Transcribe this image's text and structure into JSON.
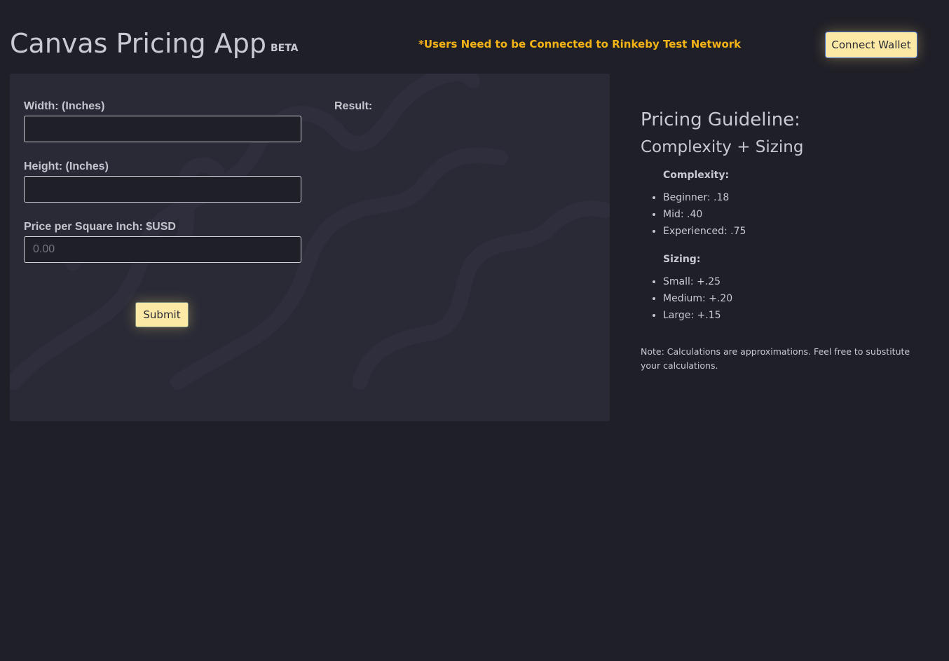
{
  "header": {
    "title": "Canvas Pricing App",
    "badge": "BETA",
    "network_notice": "*Users Need to be Connected to Rinkeby Test Network",
    "connect_wallet_label": "Connect Wallet"
  },
  "calculator": {
    "width_label": "Width: (Inches)",
    "width_value": "",
    "height_label": "Height: (Inches)",
    "height_value": "",
    "price_label": "Price per Square Inch: $USD",
    "price_placeholder": "0.00",
    "price_value": "",
    "result_label": "Result:",
    "result_value": "",
    "submit_label": "Submit"
  },
  "guideline": {
    "title": "Pricing Guideline:",
    "subtitle": "Complexity + Sizing",
    "complexity_heading": "Complexity:",
    "complexity_items": [
      "Beginner: .18",
      "Mid: .40",
      "Experienced: .75"
    ],
    "sizing_heading": "Sizing:",
    "sizing_items": [
      "Small: +.25",
      "Medium: +.20",
      "Large: +.15"
    ],
    "note": "Note: Calculations are approximations. Feel free to substitute your calculations."
  },
  "colors": {
    "background": "#1f1f28",
    "panel": "#292a36",
    "accent_button": "#fde9a6",
    "notice": "#f5b416"
  }
}
